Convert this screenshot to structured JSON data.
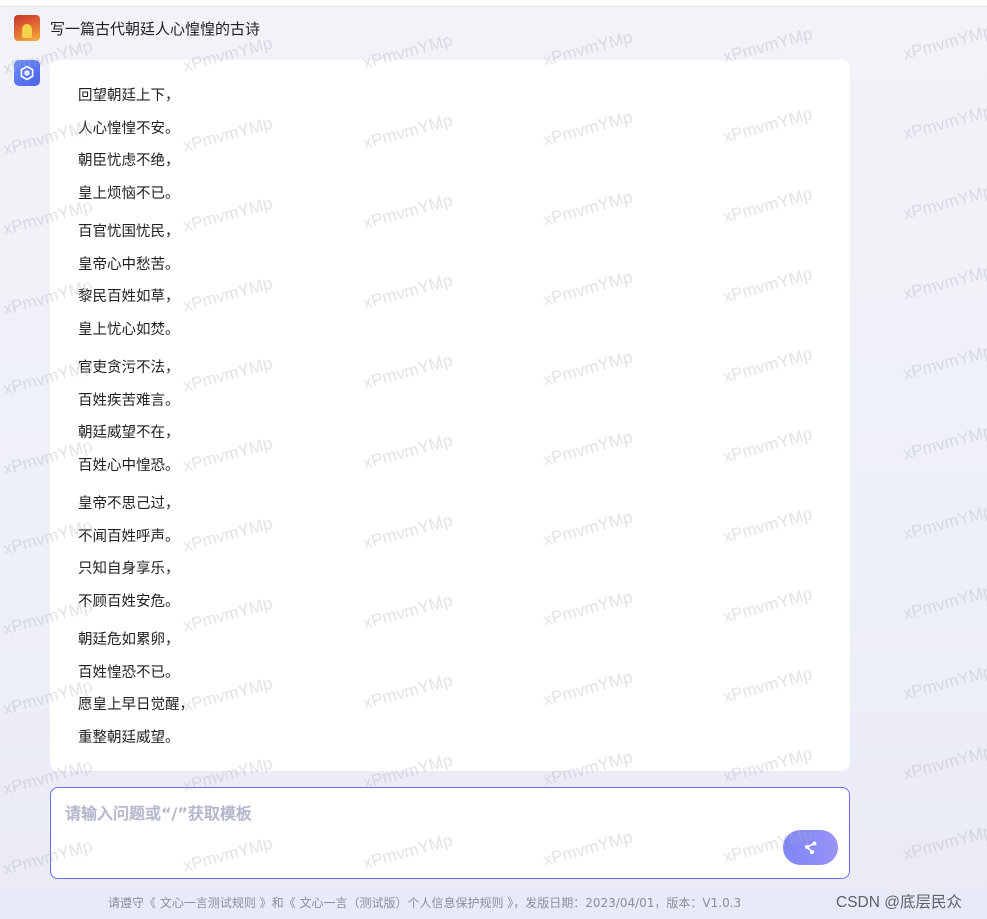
{
  "conversation": {
    "user_question": "写一篇古代朝廷人心惶惶的古诗",
    "answer_stanzas": [
      [
        "回望朝廷上下，",
        "人心惶惶不安。",
        "朝臣忧虑不绝，",
        "皇上烦恼不已。"
      ],
      [
        "百官忧国忧民，",
        "皇帝心中愁苦。",
        "黎民百姓如草，",
        "皇上忧心如焚。"
      ],
      [
        "官吏贪污不法，",
        "百姓疾苦难言。",
        "朝廷威望不在，",
        "百姓心中惶恐。"
      ],
      [
        "皇帝不思己过，",
        "不闻百姓呼声。",
        "只知自身享乐，",
        "不顾百姓安危。"
      ],
      [
        "朝廷危如累卵，",
        "百姓惶恐不已。",
        "愿皇上早日觉醒，",
        "重整朝廷威望。"
      ]
    ]
  },
  "input": {
    "placeholder": "请输入问题或“/”获取模板",
    "value": ""
  },
  "footer": {
    "note": "请遵守《 文心一言测试规则 》和《 文心一言（测试版）个人信息保护规则 》，发版日期：2023/04/01，版本：V1.0.3",
    "credit": "CSDN @底层民众"
  },
  "watermark": {
    "text": "xPmvmYMp"
  },
  "colors": {
    "accent": "#6c6ff0",
    "send_button": "#8d8ef7",
    "placeholder": "#b4b6cc",
    "footer_text": "#8c8e9c"
  },
  "icons": {
    "user_avatar": "user-avatar-image",
    "bot_avatar": "ernie-bot-logo-icon",
    "send": "send-icon"
  }
}
